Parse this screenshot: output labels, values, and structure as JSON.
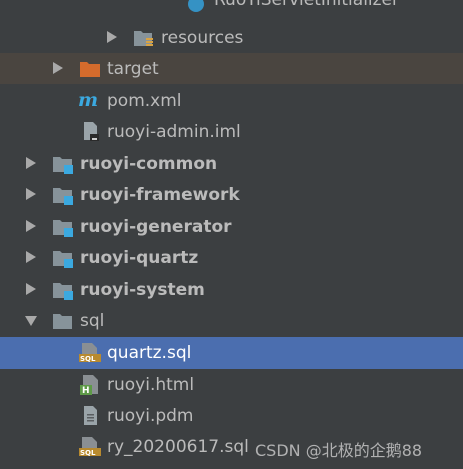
{
  "tree": {
    "partial_item": "RuoYiServletInitializer",
    "items": [
      {
        "label": "resources"
      },
      {
        "label": "target"
      },
      {
        "label": "pom.xml"
      },
      {
        "label": "ruoyi-admin.iml"
      },
      {
        "label": "ruoyi-common"
      },
      {
        "label": "ruoyi-framework"
      },
      {
        "label": "ruoyi-generator"
      },
      {
        "label": "ruoyi-quartz"
      },
      {
        "label": "ruoyi-system"
      },
      {
        "label": "sql"
      },
      {
        "label": "quartz.sql"
      },
      {
        "label": "ruoyi.html"
      },
      {
        "label": "ruoyi.pdm"
      },
      {
        "label": "ry_20200617.sql"
      }
    ]
  },
  "watermark": "CSDN @北极的企鹅88",
  "colors": {
    "background": "#3c3f41",
    "selection": "#4b6eaf",
    "target_highlight": "#4a4540",
    "folder": "#87939a",
    "module_badge": "#3ba9e0",
    "target_folder": "#d46b2c"
  }
}
